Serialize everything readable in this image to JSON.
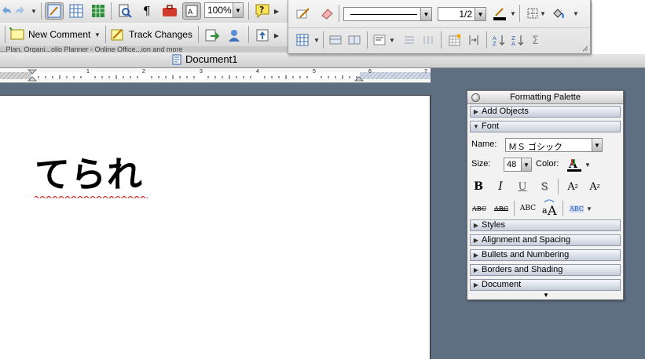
{
  "toolbar_top": {
    "zoom_value": "100%"
  },
  "toolbar_mid": {
    "new_comment_label": "New Comment",
    "track_changes_label": "Track Changes"
  },
  "tabstrip_text": "...Plan, Organi...olio Planner - Online Office...ion and more",
  "document": {
    "window_title": "Document1",
    "body_text": "てられ"
  },
  "ruler": {
    "numbers": [
      "1",
      "2",
      "3",
      "4",
      "5",
      "6",
      "7"
    ]
  },
  "drawing_toolbar": {
    "line_weight_value": "1/2"
  },
  "palette": {
    "title": "Formatting Palette",
    "sections": {
      "add_objects": "Add Objects",
      "font": "Font",
      "styles": "Styles",
      "alignment": "Alignment and Spacing",
      "bullets": "Bullets and Numbering",
      "borders": "Borders and Shading",
      "document": "Document"
    },
    "font": {
      "name_label": "Name:",
      "name_value": "ＭＳ ゴシック",
      "size_label": "Size:",
      "size_value": "48",
      "color_label": "Color:"
    },
    "format_buttons": {
      "bold": "B",
      "italic": "I",
      "underline": "U",
      "shadow": "S",
      "superscript": "A",
      "superscript_mark": "2",
      "subscript": "A",
      "subscript_mark": "2",
      "strike": "ABC",
      "double_strike": "ABC",
      "small_caps": "ABC",
      "highlight": "ABC"
    }
  },
  "colors": {
    "desktop": "#5e6f82",
    "spelling_underline": "#d40000",
    "font_color_bar": "#000000"
  }
}
